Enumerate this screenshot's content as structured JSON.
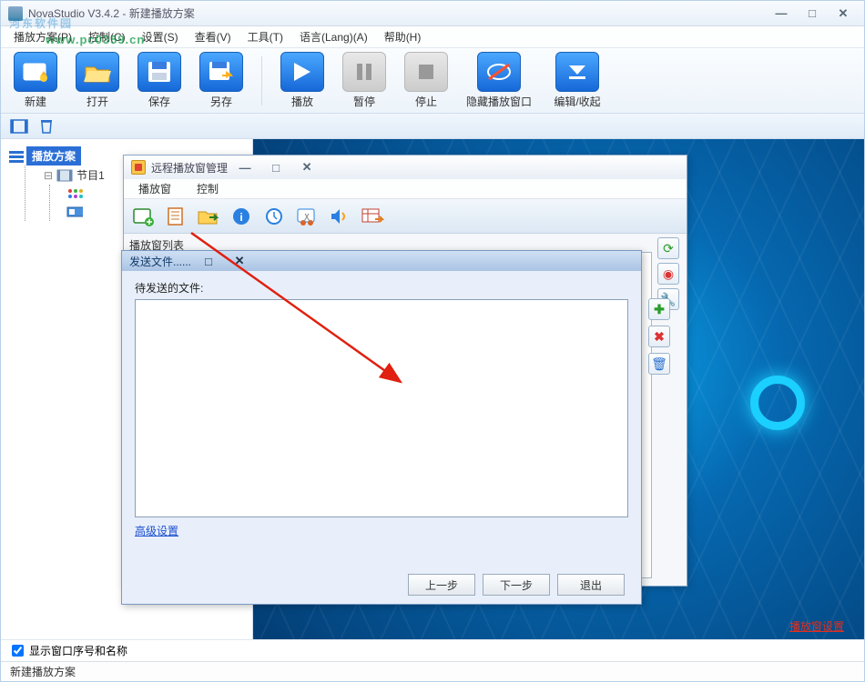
{
  "window": {
    "title": "NovaStudio V3.4.2 - 新建播放方案",
    "min": "—",
    "max": "□",
    "close": "✕"
  },
  "watermark": {
    "text": "河东软件园",
    "url": "www.pc0359.cn"
  },
  "menu": [
    "播放方案(P)",
    "控制(C)",
    "设置(S)",
    "查看(V)",
    "工具(T)",
    "语言(Lang)(A)",
    "帮助(H)"
  ],
  "toolbar": [
    {
      "label": "新建",
      "icon": "file-new-icon"
    },
    {
      "label": "打开",
      "icon": "folder-open-icon"
    },
    {
      "label": "保存",
      "icon": "save-icon"
    },
    {
      "label": "另存",
      "icon": "save-as-icon"
    },
    {
      "sep": true
    },
    {
      "label": "播放",
      "icon": "play-icon"
    },
    {
      "label": "暂停",
      "icon": "pause-icon",
      "disabled": true
    },
    {
      "label": "停止",
      "icon": "stop-icon",
      "disabled": true
    },
    {
      "label": "隐藏播放窗口",
      "icon": "hide-window-icon"
    },
    {
      "label": "编辑/收起",
      "icon": "collapse-icon"
    }
  ],
  "subtoolbar_icons": [
    "film-icon",
    "trash-icon"
  ],
  "tree": {
    "root": "播放方案",
    "child": "节目1",
    "grandchildren": [
      "multi-color-dots-icon",
      "slide-item-icon"
    ]
  },
  "footer_checkbox": "显示窗口序号和名称",
  "status_text": "新建播放方案",
  "cavity_link": "播放窗设置",
  "dialog1": {
    "title": "远程播放窗管理",
    "menu": [
      "播放窗",
      "控制"
    ],
    "tool_icons": [
      "add-window-icon",
      "doc-list-icon",
      "folder-send-icon",
      "info-icon",
      "clock-icon",
      "cut-icon",
      "volume-icon",
      "table-send-icon"
    ],
    "body_label": "播放窗列表",
    "right_icons": [
      {
        "name": "refresh-icon",
        "glyph": "⟳",
        "color": "#2a9d2a"
      },
      {
        "name": "live-icon",
        "glyph": "◉",
        "color": "#d33"
      },
      {
        "name": "settings-wrench-icon",
        "glyph": "🔧",
        "color": "#c8902a"
      }
    ],
    "win_btns": {
      "min": "—",
      "max": "□",
      "close": "✕"
    }
  },
  "dialog2": {
    "title": "发送文件......",
    "label": "待发送的文件:",
    "adv_link": "高级设置",
    "buttons": [
      "上一步",
      "下一步",
      "退出"
    ],
    "side_icons": [
      {
        "name": "add-icon",
        "glyph": "✚",
        "color": "#2a9d2a"
      },
      {
        "name": "remove-icon",
        "glyph": "✖",
        "color": "#d33"
      },
      {
        "name": "delete-icon",
        "glyph": "🗑",
        "color": "#2a6fd0"
      }
    ],
    "win_btns": {
      "max": "□",
      "close": "✕"
    }
  }
}
